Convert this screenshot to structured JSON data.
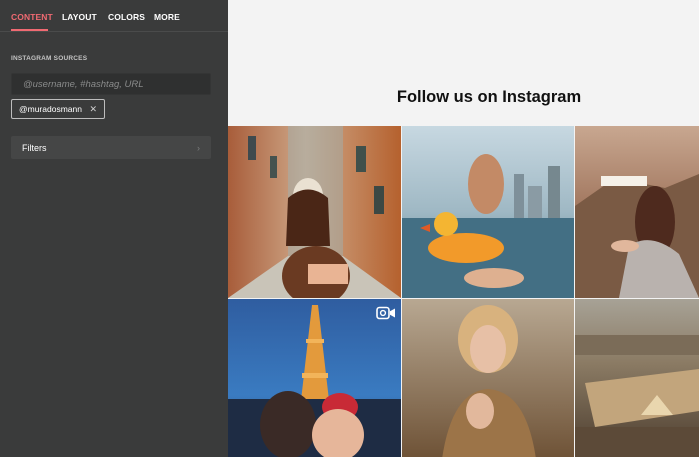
{
  "sidebar": {
    "tabs": [
      {
        "label": "CONTENT",
        "active": true
      },
      {
        "label": "LAYOUT",
        "active": false
      },
      {
        "label": "COLORS",
        "active": false
      },
      {
        "label": "MORE",
        "active": false
      }
    ],
    "sources_title": "INSTAGRAM SOURCES",
    "source_input_placeholder": "@username, #hashtag, URL",
    "source_chip": "@muradosmann",
    "chip_remove_icon": "close-icon",
    "filters_label": "Filters",
    "filters_icon": "chevron-right-icon"
  },
  "main": {
    "heading": "Follow us on Instagram",
    "posts": [
      {
        "icon": "photo-icon"
      },
      {
        "icon": "photo-icon"
      },
      {
        "icon": "photo-icon"
      },
      {
        "icon": "video-camera-icon"
      },
      {
        "icon": "photo-icon"
      },
      {
        "icon": "photo-icon"
      }
    ]
  },
  "colors": {
    "sidebar_bg": "#3a3b3b",
    "accent": "#f06a72",
    "main_bg": "#f3f3f3"
  }
}
